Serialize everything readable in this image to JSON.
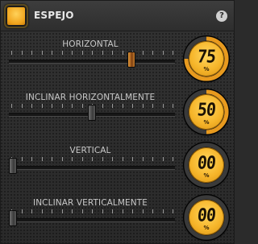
{
  "header": {
    "title": "ESPEJO",
    "icon": "mirror-effect-icon",
    "help_icon_glyph": "?"
  },
  "controls": [
    {
      "id": "horizontal",
      "label": "HORIZONTAL",
      "value": "75",
      "value_number": 75,
      "unit": "%",
      "thumb_style": "orange"
    },
    {
      "id": "inclinar-horizontalmente",
      "label": "INCLINAR HORIZONTALMENTE",
      "value": "50",
      "value_number": 50,
      "unit": "%",
      "thumb_style": "gray"
    },
    {
      "id": "vertical",
      "label": "VERTICAL",
      "value": "00",
      "value_number": 0,
      "unit": "%",
      "thumb_style": "gray"
    },
    {
      "id": "inclinar-verticalmente",
      "label": "INCLINAR VERTICALMENTE",
      "value": "00",
      "value_number": 0,
      "unit": "%",
      "thumb_style": "gray"
    }
  ],
  "colors": {
    "accent": "#f6b52a",
    "accent_dark": "#d48f14",
    "ring_active": "#e89a1e",
    "ring_inactive": "#3a3a3a",
    "panel_bg": "#2e2e2e",
    "text": "#c8c8c8"
  }
}
